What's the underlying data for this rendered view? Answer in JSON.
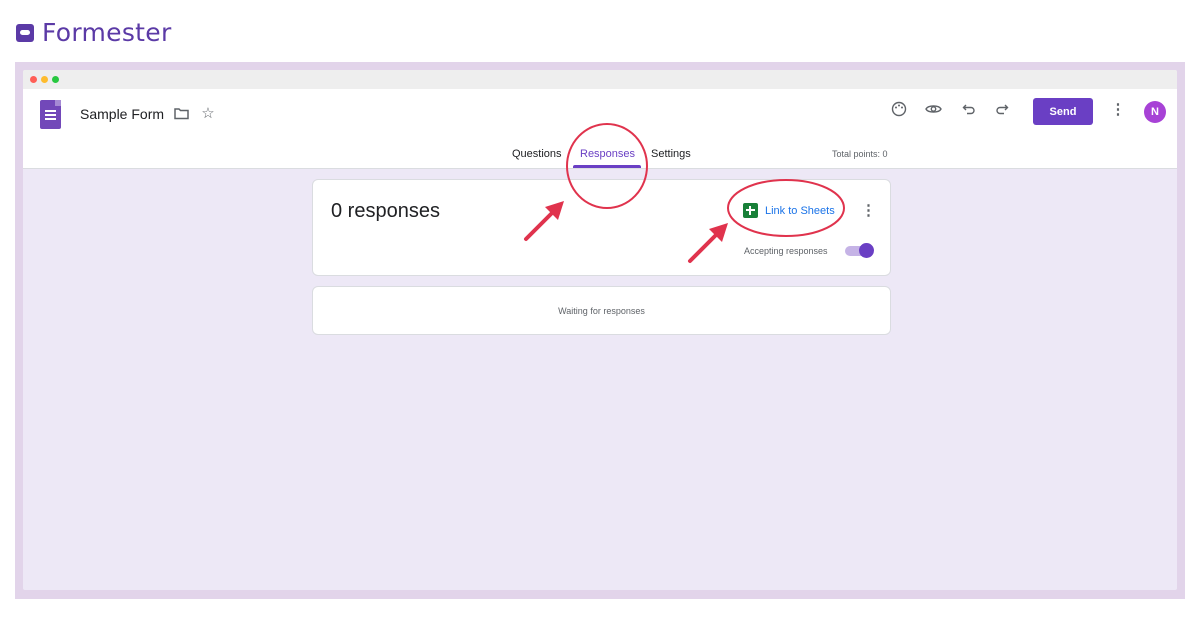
{
  "brand": {
    "name": "Formester",
    "icon": "formester-logo"
  },
  "form": {
    "title": "Sample Form",
    "icon": "forms-doc-icon"
  },
  "toolbar": {
    "icons": [
      "folder-icon",
      "star-icon",
      "palette-icon",
      "preview-eye-icon",
      "undo-icon",
      "redo-icon",
      "more-vert-icon"
    ],
    "send_label": "Send",
    "avatar_initial": "N"
  },
  "tabs": [
    {
      "label": "Questions",
      "active": false
    },
    {
      "label": "Responses",
      "active": true
    },
    {
      "label": "Settings",
      "active": false
    }
  ],
  "total_points": "Total points: 0",
  "responses": {
    "count_label": "0 responses",
    "link_sheets_label": "Link to Sheets",
    "accepting_label": "Accepting responses",
    "accepting": true,
    "waiting_label": "Waiting for responses"
  },
  "colors": {
    "accent": "#6a3fc4",
    "brand": "#5b3aa6",
    "annotation": "#e0334d",
    "sheets": "#188038",
    "link": "#1a73e8"
  }
}
